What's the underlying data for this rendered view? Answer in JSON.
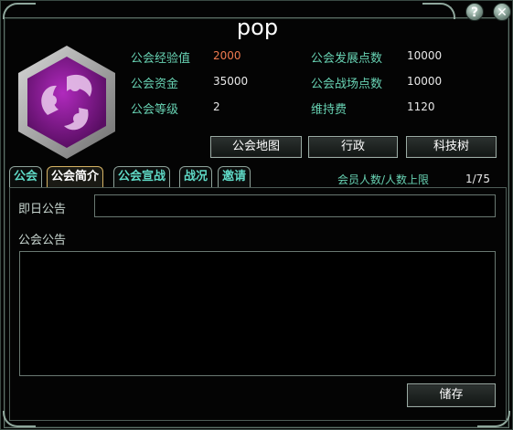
{
  "window": {
    "title": "pop",
    "help_symbol": "?",
    "close_symbol": "✕"
  },
  "emblem": {
    "icon": "guild-emblem-icon",
    "outer_color": "#9c9c9c",
    "inner_color": "#7a1a86"
  },
  "stats": {
    "exp_label": "公会经验值",
    "exp_value": "2000",
    "funds_label": "公会资金",
    "funds_value": "35000",
    "level_label": "公会等级",
    "level_value": "2",
    "dev_label": "公会发展点数",
    "dev_value": "10000",
    "battle_label": "公会战场点数",
    "battle_value": "10000",
    "upkeep_label": "维持费",
    "upkeep_value": "1120"
  },
  "actions": {
    "map_label": "公会地图",
    "admin_label": "行政",
    "tech_label": "科技树"
  },
  "tabs": [
    "公会",
    "公会简介",
    "公会宣战",
    "战况",
    "邀请"
  ],
  "members": {
    "label": "会员人数/人数上限",
    "value": "1/75"
  },
  "content": {
    "daily_label": "即日公告",
    "daily_value": "",
    "notice_label": "公会公告",
    "notice_value": "",
    "save_label": "储存"
  },
  "colors": {
    "accent_text": "#67d1b2",
    "orange_value": "#f07a4f",
    "active_tab_border": "#d7b465"
  }
}
